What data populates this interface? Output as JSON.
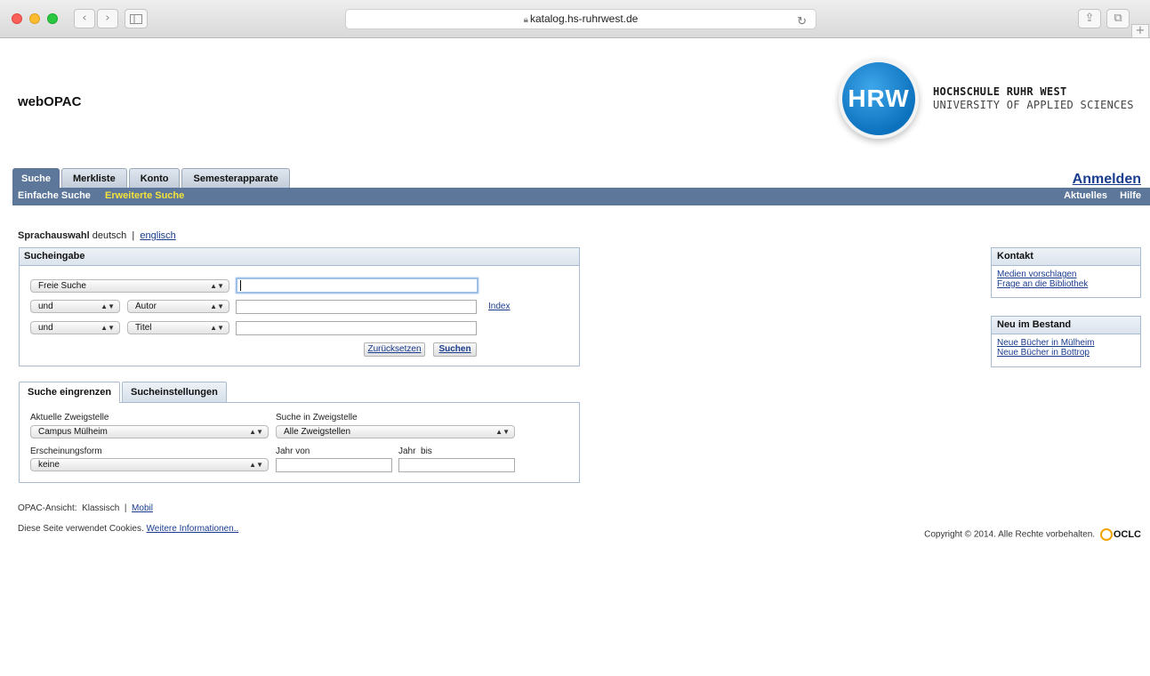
{
  "browser": {
    "url": "katalog.hs-ruhrwest.de",
    "back_glyph": "‹",
    "forward_glyph": "›",
    "reload_glyph": "↻",
    "share_glyph": "⇪",
    "tabs_glyph": "⧉",
    "newtab_glyph": "+"
  },
  "header": {
    "brand": "webOPAC",
    "logo_abbr": "HRW",
    "logo_line1": "HOCHSCHULE RUHR WEST",
    "logo_line2": "UNIVERSITY OF APPLIED SCIENCES"
  },
  "tabs": [
    "Suche",
    "Merkliste",
    "Konto",
    "Semesterapparate"
  ],
  "login_label": "Anmelden",
  "subnav": {
    "simple": "Einfache Suche",
    "advanced": "Erweiterte Suche",
    "news": "Aktuelles",
    "help": "Hilfe"
  },
  "language": {
    "label": "Sprachauswahl",
    "current": "deutsch",
    "separator": "|",
    "other": "englisch"
  },
  "search": {
    "title": "Sucheingabe",
    "row1_field": "Freie Suche",
    "row2_op": "und",
    "row2_field": "Autor",
    "row3_op": "und",
    "row3_field": "Titel",
    "index_link": "Index",
    "reset_label": "Zurücksetzen",
    "submit_label": "Suchen"
  },
  "filter": {
    "tab_active": "Suche eingrenzen",
    "tab_inactive": "Sucheinstellungen",
    "branch_label": "Aktuelle Zweigstelle",
    "branch_value": "Campus Mülheim",
    "search_in_label": "Suche in Zweigstelle",
    "search_in_value": "Alle Zweigstellen",
    "form_label": "Erscheinungsform",
    "form_value": "keine",
    "year_from_label": "Jahr von",
    "year_to_label": "Jahr  bis"
  },
  "footer": {
    "view_label": "OPAC-Ansicht:",
    "view_classic": "Klassisch",
    "view_sep": "|",
    "view_mobile": "Mobil",
    "cookies_text": "Diese Seite verwendet Cookies.",
    "cookies_link": "Weitere Informationen..",
    "copyright": "Copyright © 2014. Alle Rechte vorbehalten.",
    "oclc": "OCLC"
  },
  "sidebar": {
    "contact_title": "Kontakt",
    "contact_links": [
      "Medien vorschlagen",
      "Frage an die Bibliothek"
    ],
    "new_title": "Neu im Bestand",
    "new_links": [
      "Neue Bücher in Mülheim",
      "Neue Bücher in Bottrop"
    ]
  },
  "colors": {
    "nav_bar": "#5c7799",
    "highlight": "#f5e23a",
    "link": "#1a3c8f",
    "logo_blue": "#0c72be"
  }
}
